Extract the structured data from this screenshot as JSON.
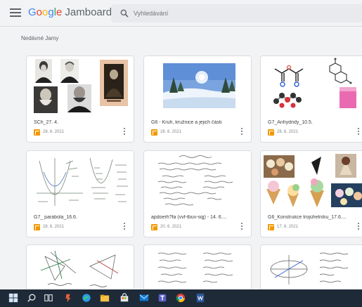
{
  "header": {
    "logo_letters": [
      "G",
      "o",
      "o",
      "g",
      "l",
      "e"
    ],
    "product_name": "Jamboard",
    "search_placeholder": "Vyhledávání"
  },
  "section_title": "Nedávné Jamy",
  "jams": [
    {
      "title": "SCh_27. 4.",
      "date": "28. 6. 2021"
    },
    {
      "title": "G6 - Kruh, kružnice a jejich části",
      "date": "28. 6. 2021"
    },
    {
      "title": "G7_Anhydridy_10.5.",
      "date": "28. 6. 2021"
    },
    {
      "title": "G7_ parabola_16.6.",
      "date": "28. 6. 2021"
    },
    {
      "title": "apdoerh?fa (vvf-tbuv-sqj) - 14. 6....",
      "date": "20. 6. 2021"
    },
    {
      "title": "G6_Konstrukce trojúhelníku_17.6....",
      "date": "17. 6. 2021"
    }
  ],
  "colors": {
    "background": "#f1f3f4",
    "jam_icon": "#f29900",
    "taskbar": "#1f2a38",
    "card_border": "#dadce0"
  },
  "taskbar_icons": [
    "windows-icon",
    "search-icon",
    "task-view-icon",
    "app-icon",
    "edge-icon",
    "file-explorer-icon",
    "store-icon",
    "mail-icon",
    "teams-icon",
    "chrome-icon",
    "word-icon"
  ]
}
